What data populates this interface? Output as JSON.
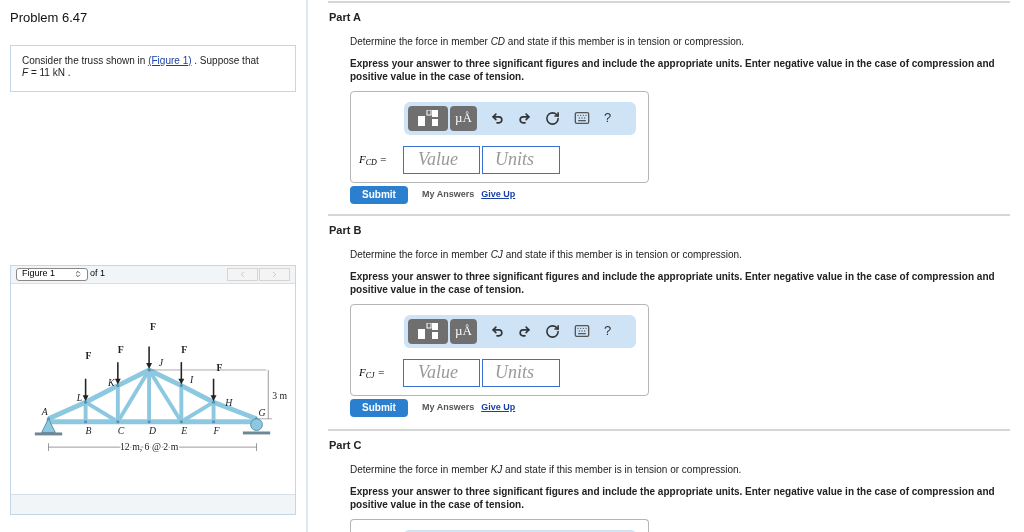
{
  "problem": {
    "title": "Problem 6.47",
    "statement_before": "Consider the truss shown in ",
    "figure_link": "(Figure 1)",
    "statement_after": " . Suppose that",
    "formula": "*F* = 11  kN ."
  },
  "figure": {
    "selector": "Figure 1",
    "count_label": "of 1",
    "nav": [
      {
        "kind": "prev",
        "disabled": true
      },
      {
        "kind": "next",
        "disabled": true
      }
    ],
    "labels": [
      "F",
      "F",
      "F",
      "F",
      "F",
      "L",
      "K",
      "J",
      "I",
      "H",
      "A",
      "G",
      "B",
      "C",
      "D",
      "E",
      "F",
      "3 m",
      "12 m, 6 @ 2 m"
    ]
  },
  "parts": [
    {
      "title": "Part A",
      "question": "Determine the force in member *CD* and state if this member is in tension or compression.",
      "instruction": "Express your answer to three significant figures and include the appropriate units. Enter negative value in the case of compression and positive value in the case of tension.",
      "units_button": "µÅ",
      "help": "?",
      "answer": {
        "label": "F$_{CD}$ =",
        "value_placeholder": "Value",
        "units_placeholder": "Units",
        "submit": "Submit",
        "my_answers": "My Answers",
        "give_up": "Give Up"
      }
    },
    {
      "title": "Part B",
      "question": "Determine the force in member *CJ* and state if this member is in tension or compression.",
      "instruction": "Express your answer to three significant figures and include the appropriate units. Enter negative value in the case of compression and positive value in the case of tension.",
      "units_button": "µÅ",
      "help": "?",
      "answer": {
        "label": "F$_{CJ}$ =",
        "value_placeholder": "Value",
        "units_placeholder": "Units",
        "submit": "Submit",
        "my_answers": "My Answers",
        "give_up": "Give Up"
      }
    },
    {
      "title": "Part C",
      "question": "Determine the force in member *KJ* and state if this member is in tension or compression.",
      "instruction": "Express your answer to three significant figures and include the appropriate units. Enter negative value in the case of compression and positive value in the case of tension."
    }
  ]
}
